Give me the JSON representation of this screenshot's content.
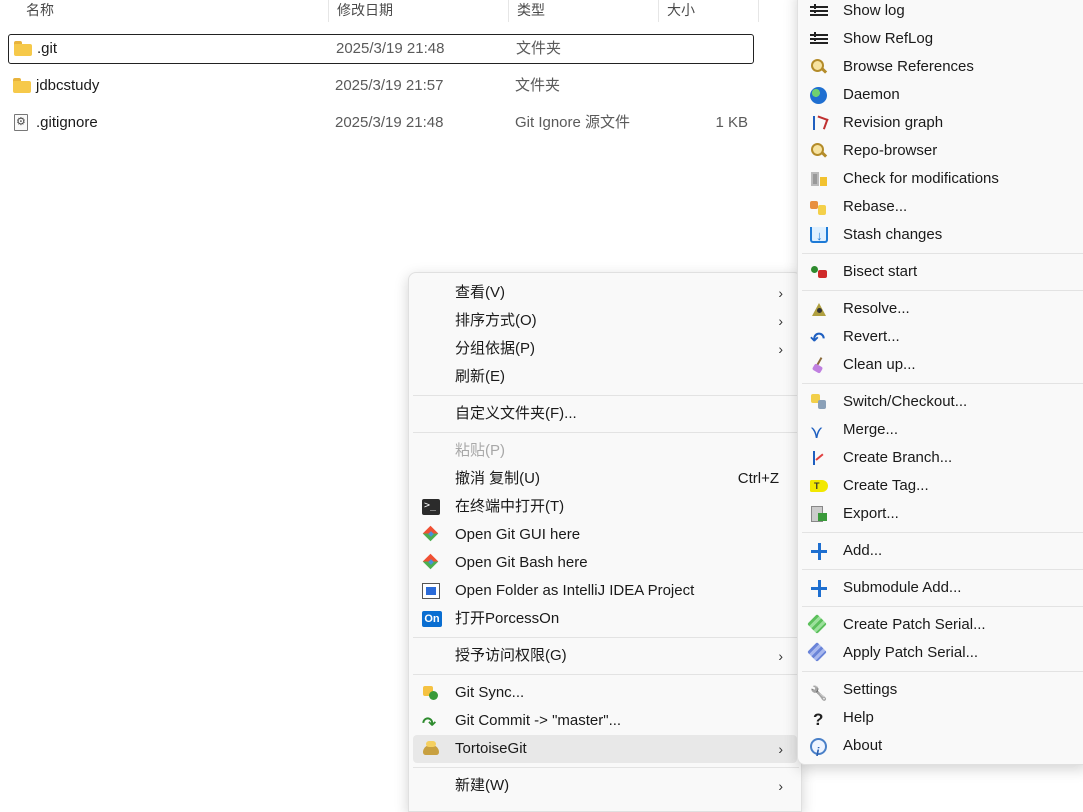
{
  "file_list": {
    "columns": [
      "名称",
      "修改日期",
      "类型",
      "大小"
    ],
    "rows": [
      {
        "name": ".git",
        "date": "2025/3/19 21:48",
        "type": "文件夹",
        "size": "",
        "icon": "folder-icon",
        "focused": true
      },
      {
        "name": "jdbcstudy",
        "date": "2025/3/19 21:57",
        "type": "文件夹",
        "size": "",
        "icon": "folder-icon",
        "focused": false
      },
      {
        "name": ".gitignore",
        "date": "2025/3/19 21:48",
        "type": "Git Ignore 源文件",
        "size": "1 KB",
        "icon": "settings-file-icon",
        "focused": false
      }
    ]
  },
  "context_menu": {
    "items": [
      {
        "label": "查看(V)",
        "has_submenu": true
      },
      {
        "label": "排序方式(O)",
        "has_submenu": true
      },
      {
        "label": "分组依据(P)",
        "has_submenu": true
      },
      {
        "label": "刷新(E)"
      },
      {
        "label": "自定义文件夹(F)..."
      },
      {
        "label": "粘贴(P)",
        "disabled": true
      },
      {
        "label": "撤消 复制(U)",
        "shortcut": "Ctrl+Z"
      },
      {
        "label": "在终端中打开(T)",
        "icon": "terminal-icon"
      },
      {
        "label": "Open Git GUI here",
        "icon": "git-icon"
      },
      {
        "label": "Open Git Bash here",
        "icon": "git-icon"
      },
      {
        "label": "Open Folder as IntelliJ IDEA Project",
        "icon": "intellij-icon"
      },
      {
        "label": "打开PorcessOn",
        "icon": "processon-icon",
        "icon_text": "On"
      },
      {
        "label": "授予访问权限(G)",
        "has_submenu": true
      },
      {
        "label": "Git Sync...",
        "icon": "git-sync-icon"
      },
      {
        "label": "Git Commit -> \"master\"...",
        "icon": "git-commit-icon"
      },
      {
        "label": "TortoiseGit",
        "icon": "tortoisegit-icon",
        "has_submenu": true,
        "highlighted": true
      },
      {
        "label": "新建(W)",
        "has_submenu": true
      }
    ],
    "arrow_glyph": "›"
  },
  "tortoisegit_submenu": {
    "items": [
      {
        "label": "Show log",
        "icon": "show-log-icon"
      },
      {
        "label": "Show RefLog",
        "icon": "show-reflog-icon"
      },
      {
        "label": "Browse References",
        "icon": "browse-references-icon"
      },
      {
        "label": "Daemon",
        "icon": "daemon-globe-icon"
      },
      {
        "label": "Revision graph",
        "icon": "revision-graph-icon"
      },
      {
        "label": "Repo-browser",
        "icon": "repo-browser-icon"
      },
      {
        "label": "Check for modifications",
        "icon": "check-modifications-icon"
      },
      {
        "label": "Rebase...",
        "icon": "rebase-icon"
      },
      {
        "label": "Stash changes",
        "icon": "stash-icon"
      },
      {
        "label": "Bisect start",
        "icon": "bisect-icon"
      },
      {
        "label": "Resolve...",
        "icon": "resolve-icon"
      },
      {
        "label": "Revert...",
        "icon": "revert-icon"
      },
      {
        "label": "Clean up...",
        "icon": "cleanup-broom-icon"
      },
      {
        "label": "Switch/Checkout...",
        "icon": "switch-checkout-icon"
      },
      {
        "label": "Merge...",
        "icon": "merge-icon"
      },
      {
        "label": "Create Branch...",
        "icon": "create-branch-icon"
      },
      {
        "label": "Create Tag...",
        "icon": "create-tag-icon"
      },
      {
        "label": "Export...",
        "icon": "export-icon"
      },
      {
        "label": "Add...",
        "icon": "add-plus-icon"
      },
      {
        "label": "Submodule Add...",
        "icon": "submodule-add-icon"
      },
      {
        "label": "Create Patch Serial...",
        "icon": "create-patch-icon"
      },
      {
        "label": "Apply Patch Serial...",
        "icon": "apply-patch-icon"
      },
      {
        "label": "Settings",
        "icon": "settings-wrench-icon"
      },
      {
        "label": "Help",
        "icon": "help-icon"
      },
      {
        "label": "About",
        "icon": "about-info-icon"
      }
    ]
  }
}
